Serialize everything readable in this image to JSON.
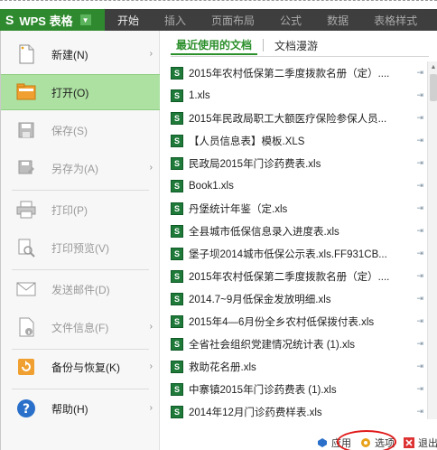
{
  "app": {
    "logo_letter": "S",
    "name": "WPS 表格",
    "dropdown_glyph": "▼"
  },
  "ribbon_tabs": [
    "开始",
    "插入",
    "页面布局",
    "公式",
    "数据",
    "表格样式"
  ],
  "menu": {
    "items": [
      {
        "label": "新建(N)",
        "icon": "new-document-icon",
        "has_submenu": true,
        "enabled": true,
        "active": false
      },
      {
        "label": "打开(O)",
        "icon": "open-folder-icon",
        "has_submenu": false,
        "enabled": true,
        "active": true
      },
      {
        "label": "保存(S)",
        "icon": "save-icon",
        "has_submenu": false,
        "enabled": false,
        "active": false
      },
      {
        "label": "另存为(A)",
        "icon": "save-as-icon",
        "has_submenu": true,
        "enabled": false,
        "active": false
      },
      {
        "label": "打印(P)",
        "icon": "printer-icon",
        "has_submenu": false,
        "enabled": false,
        "active": false
      },
      {
        "label": "打印预览(V)",
        "icon": "print-preview-icon",
        "has_submenu": false,
        "enabled": false,
        "active": false
      },
      {
        "label": "发送邮件(D)",
        "icon": "mail-icon",
        "has_submenu": false,
        "enabled": false,
        "active": false
      },
      {
        "label": "文件信息(F)",
        "icon": "file-info-icon",
        "has_submenu": true,
        "enabled": false,
        "active": false
      },
      {
        "label": "备份与恢复(K)",
        "icon": "backup-icon",
        "has_submenu": true,
        "enabled": true,
        "active": false
      },
      {
        "label": "帮助(H)",
        "icon": "help-icon",
        "has_submenu": true,
        "enabled": true,
        "active": false
      }
    ],
    "submenu_glyph": "›"
  },
  "recent": {
    "tabs": [
      "最近使用的文档",
      "文档漫游"
    ],
    "file_icon_letter": "S",
    "pin_glyph": "⇥",
    "files": [
      "2015年农村低保第二季度拨款名册（定）....",
      "1.xls",
      "2015年民政局职工大额医疗保险参保人员...",
      "【人员信息表】模板.XLS",
      "民政局2015年门诊药费表.xls",
      "Book1.xls",
      "丹堡统计年鉴（定.xls",
      "全县城市低保信息录入进度表.xls",
      "堡子坝2014城市低保公示表.xls.FF931CB...",
      "2015年农村低保第二季度拨款名册（定）....",
      "2014.7~9月低保金发放明细.xls",
      "2015年4—6月份全乡农村低保拨付表.xls",
      "全省社会组织党建情况统计表 (1).xls",
      "救助花名册.xls",
      "中寨镇2015年门诊药费表 (1).xls",
      "2014年12月门诊药费样表.xls"
    ]
  },
  "bottom": {
    "apps_label": "应用",
    "options_label": "选项",
    "exit_label": "退出"
  },
  "colors": {
    "accent_green": "#2b8f2b",
    "active_item_bg": "#ace1a1",
    "highlight_circle": "#e01b1b"
  }
}
